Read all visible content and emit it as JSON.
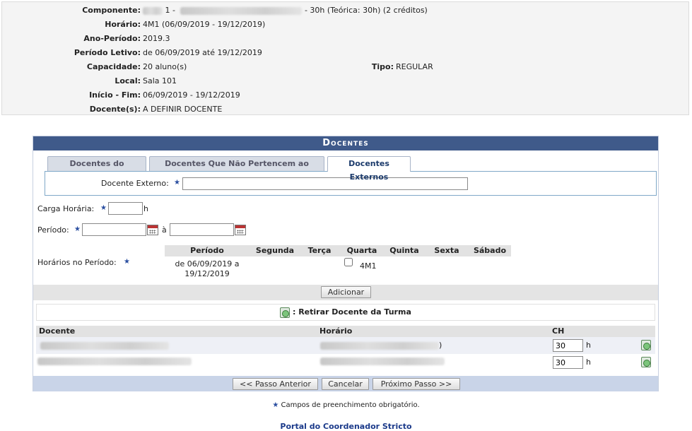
{
  "turma_info": {
    "componente_label": "Componente:",
    "componente_suffix": "- 30h (Teórica: 30h) (2 créditos)",
    "componente_code_tail": "1 -",
    "horario_label": "Horário:",
    "horario_value": "4M1 (06/09/2019 - 19/12/2019)",
    "ano_periodo_label": "Ano-Período:",
    "ano_periodo_value": "2019.3",
    "periodo_letivo_label": "Período Letivo:",
    "periodo_letivo_value": "de 06/09/2019 até 19/12/2019",
    "capacidade_label": "Capacidade:",
    "capacidade_value": "20 aluno(s)",
    "tipo_label": "Tipo:",
    "tipo_value": "REGULAR",
    "local_label": "Local:",
    "local_value": "Sala 101",
    "inicio_fim_label": "Início - Fim:",
    "inicio_fim_value": "06/09/2019 - 19/12/2019",
    "docentes_label": "Docente(s):",
    "docentes_value": "A DEFINIR DOCENTE"
  },
  "panel": {
    "title": "Docentes",
    "tabs": [
      {
        "label": "Docentes do Programa",
        "active": false
      },
      {
        "label": "Docentes Que Não Pertencem ao Programa",
        "active": false
      },
      {
        "label": "Docentes Externos",
        "active": true
      }
    ],
    "docente_externo_label": "Docente Externo:",
    "docente_externo_value": "",
    "carga_horaria_label": "Carga Horária:",
    "carga_horaria_value": "",
    "carga_horaria_unit": "h",
    "periodo_label": "Período:",
    "periodo_inicio_value": "",
    "periodo_separator": "à",
    "periodo_fim_value": "",
    "horarios_label": "Horários no Período:",
    "sched_columns": [
      "Período",
      "Segunda",
      "Terça",
      "Quarta",
      "Quinta",
      "Sexta",
      "Sábado"
    ],
    "sched_row": {
      "periodo_line1": "de 06/09/2019 a",
      "periodo_line2": "19/12/2019",
      "quarta_slot": "4M1",
      "quarta_checked": false
    },
    "adicionar_label": "Adicionar",
    "retirar_label": ": Retirar Docente da Turma",
    "doc_columns": {
      "docente": "Docente",
      "horario": "Horário",
      "ch": "CH"
    },
    "doc_rows": [
      {
        "horario_visible": ")",
        "ch": "30",
        "unit": "h"
      },
      {
        "horario_visible": "",
        "ch": "30",
        "unit": "h"
      }
    ],
    "buttons": {
      "anterior": "<< Passo Anterior",
      "cancelar": "Cancelar",
      "proximo": "Próximo Passo >>"
    }
  },
  "legend_text": "Campos de preenchimento obrigatório.",
  "portal_link": "Portal do Coordenador Stricto",
  "colors": {
    "header_bg": "#3f5a8a",
    "footer_bar": "#c9d4e8",
    "link": "#1b3a8a",
    "required_star": "#2a4ea0"
  }
}
